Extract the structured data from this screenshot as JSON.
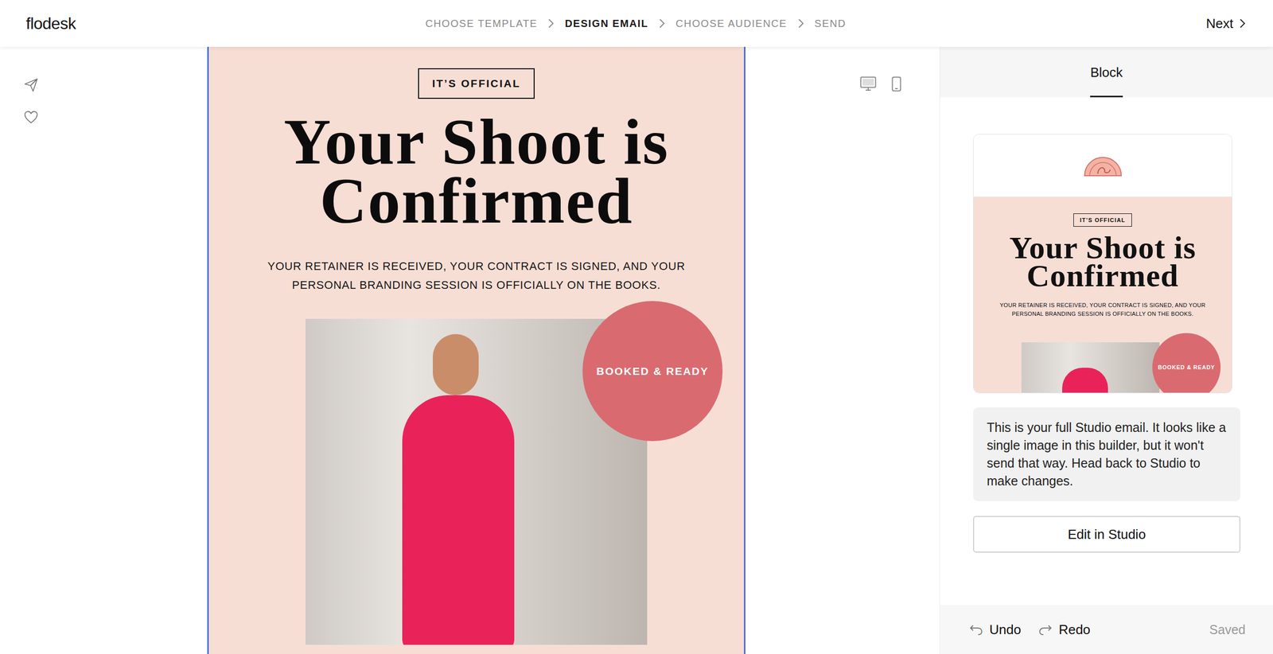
{
  "header": {
    "logo": "flodesk",
    "steps": [
      {
        "label": "CHOOSE TEMPLATE",
        "selected": false
      },
      {
        "label": "DESIGN EMAIL",
        "selected": true
      },
      {
        "label": "CHOOSE AUDIENCE",
        "selected": false
      },
      {
        "label": "SEND",
        "selected": false
      }
    ],
    "next": "Next"
  },
  "email": {
    "eyebrow": "IT’S OFFICIAL",
    "headline": [
      "Your Shoot is",
      "Confirmed"
    ],
    "subtext": "YOUR RETAINER IS RECEIVED, YOUR CONTRACT IS SIGNED, AND YOUR PERSONAL BRANDING SESSION IS OFFICIALLY ON THE BOOKS.",
    "badge": "BOOKED & READY"
  },
  "panel": {
    "tabs": [
      {
        "label": "Block",
        "selected": true
      }
    ],
    "preview": {
      "eyebrow": "IT’S OFFICIAL",
      "headline": [
        "Your Shoot is",
        "Confirmed"
      ],
      "subtext": "YOUR RETAINER IS RECEIVED, YOUR CONTRACT IS SIGNED, AND YOUR PERSONAL BRANDING SESSION IS OFFICIALLY ON THE BOOKS.",
      "badge": "BOOKED & READY"
    },
    "notice": "This is your full Studio email. It looks like a single image in this builder, but it won't send that way. Head back to Studio to make changes.",
    "button": "Edit in Studio",
    "undo": "Undo",
    "redo": "Redo",
    "status": "Saved"
  }
}
